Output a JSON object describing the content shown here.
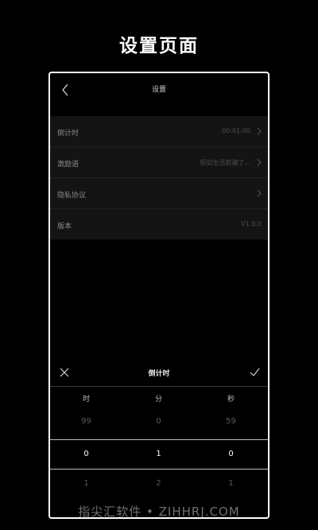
{
  "headline": "设置页面",
  "titlebar": {
    "title": "设置",
    "back_icon": "chevron-left-icon"
  },
  "settings": {
    "items": [
      {
        "label": "倒计时",
        "value": "00:01:00",
        "chevron": true
      },
      {
        "label": "激励语",
        "value": "假如生活欺骗了...",
        "chevron": true
      },
      {
        "label": "隐私协议",
        "value": "",
        "chevron": true
      },
      {
        "label": "版本",
        "value": "V1.0.0",
        "chevron": false
      }
    ]
  },
  "picker": {
    "title": "倒计时",
    "close_icon": "close-icon",
    "confirm_icon": "check-icon",
    "columns": [
      "时",
      "分",
      "秒"
    ],
    "above": [
      "99",
      "0",
      "59"
    ],
    "selected": [
      "0",
      "1",
      "0"
    ],
    "below": [
      "1",
      "2",
      "1"
    ]
  },
  "watermark": "指尖汇软件 • ZIHHRJ.COM",
  "colors": {
    "background": "#000000",
    "panel": "#141414",
    "frame": "#ffffff"
  }
}
